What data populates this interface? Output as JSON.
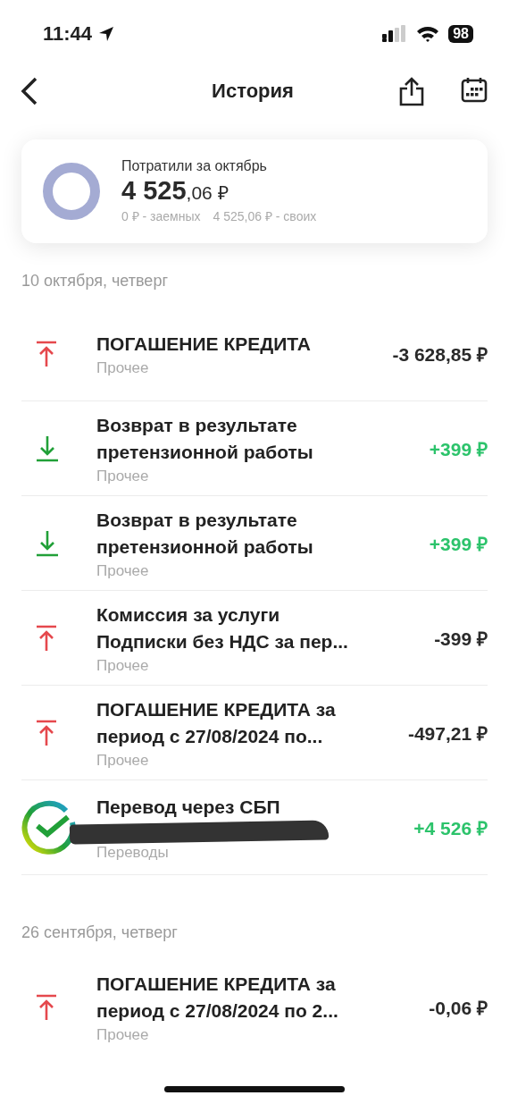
{
  "status_bar": {
    "time": "11:44",
    "battery": "98"
  },
  "header": {
    "title": "История"
  },
  "summary": {
    "label": "Потратили за октябрь",
    "amount_whole": "4 525",
    "amount_fraction": ",06 ₽",
    "borrowed": "0 ₽ - заемных",
    "own": "4 525,06 ₽ - своих"
  },
  "groups": [
    {
      "date": "10 октября, четверг",
      "transactions": [
        {
          "kind": "outgoing",
          "title": "ПОГАШЕНИЕ КРЕДИТА",
          "category": "Прочее",
          "amount": "-3 628,85 ₽"
        },
        {
          "kind": "incoming",
          "title": "Возврат в результате\nпретензионной работы",
          "category": "Прочее",
          "amount": "+399 ₽"
        },
        {
          "kind": "incoming",
          "title": "Возврат в результате\nпретензионной работы",
          "category": "Прочее",
          "amount": "+399 ₽"
        },
        {
          "kind": "outgoing",
          "title": "Комиссия за услуги\nПодписки без НДС за пер...",
          "category": "Прочее",
          "amount": "-399 ₽"
        },
        {
          "kind": "outgoing",
          "title": "ПОГАШЕНИЕ КРЕДИТА за\nпериод с 27/08/2024 по...",
          "category": "Прочее",
          "amount": "-497,21 ₽"
        },
        {
          "kind": "transfer",
          "title": "Перевод через СБП",
          "category": "Переводы",
          "amount": "+4 526 ₽"
        }
      ]
    },
    {
      "date": "26 сентября, четверг",
      "transactions": [
        {
          "kind": "outgoing",
          "title": "ПОГАШЕНИЕ КРЕДИТА за\nпериод с 27/08/2024 по 2...",
          "category": "Прочее",
          "amount": "-0,06 ₽"
        }
      ]
    }
  ]
}
